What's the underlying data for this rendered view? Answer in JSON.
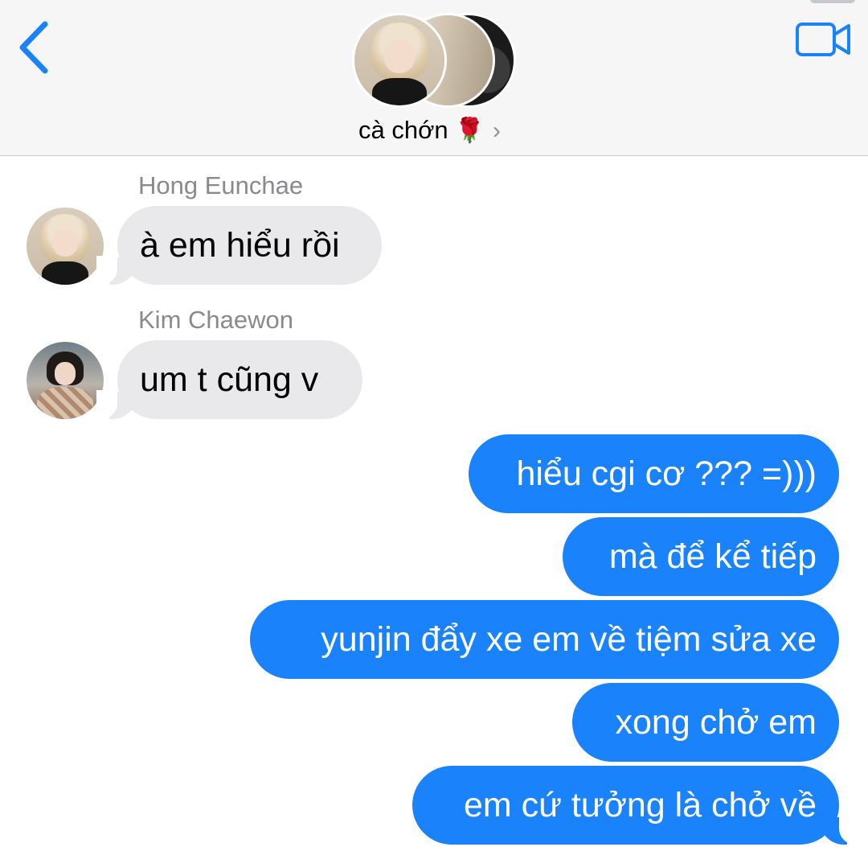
{
  "header": {
    "group_name": "cà chớn",
    "group_emoji": "🌹",
    "chevron": "›",
    "accent_color": "#1a82fb",
    "icons": {
      "back": "chevron-left-icon",
      "video": "video-camera-icon",
      "disclosure": "chevron-right-icon"
    }
  },
  "messages": [
    {
      "direction": "incoming",
      "sender": "Hong Eunchae",
      "text": "à em hiểu rồi"
    },
    {
      "direction": "incoming",
      "sender": "Kim Chaewon",
      "text": "um t cũng v"
    },
    {
      "direction": "outgoing",
      "text": "hiểu cgi cơ ??? =)))"
    },
    {
      "direction": "outgoing",
      "text": "mà để kể tiếp"
    },
    {
      "direction": "outgoing",
      "text": "yunjin đẩy xe em về tiệm sửa xe"
    },
    {
      "direction": "outgoing",
      "text": "xong chở em"
    },
    {
      "direction": "outgoing",
      "text": "em cứ tưởng là chở về"
    }
  ]
}
